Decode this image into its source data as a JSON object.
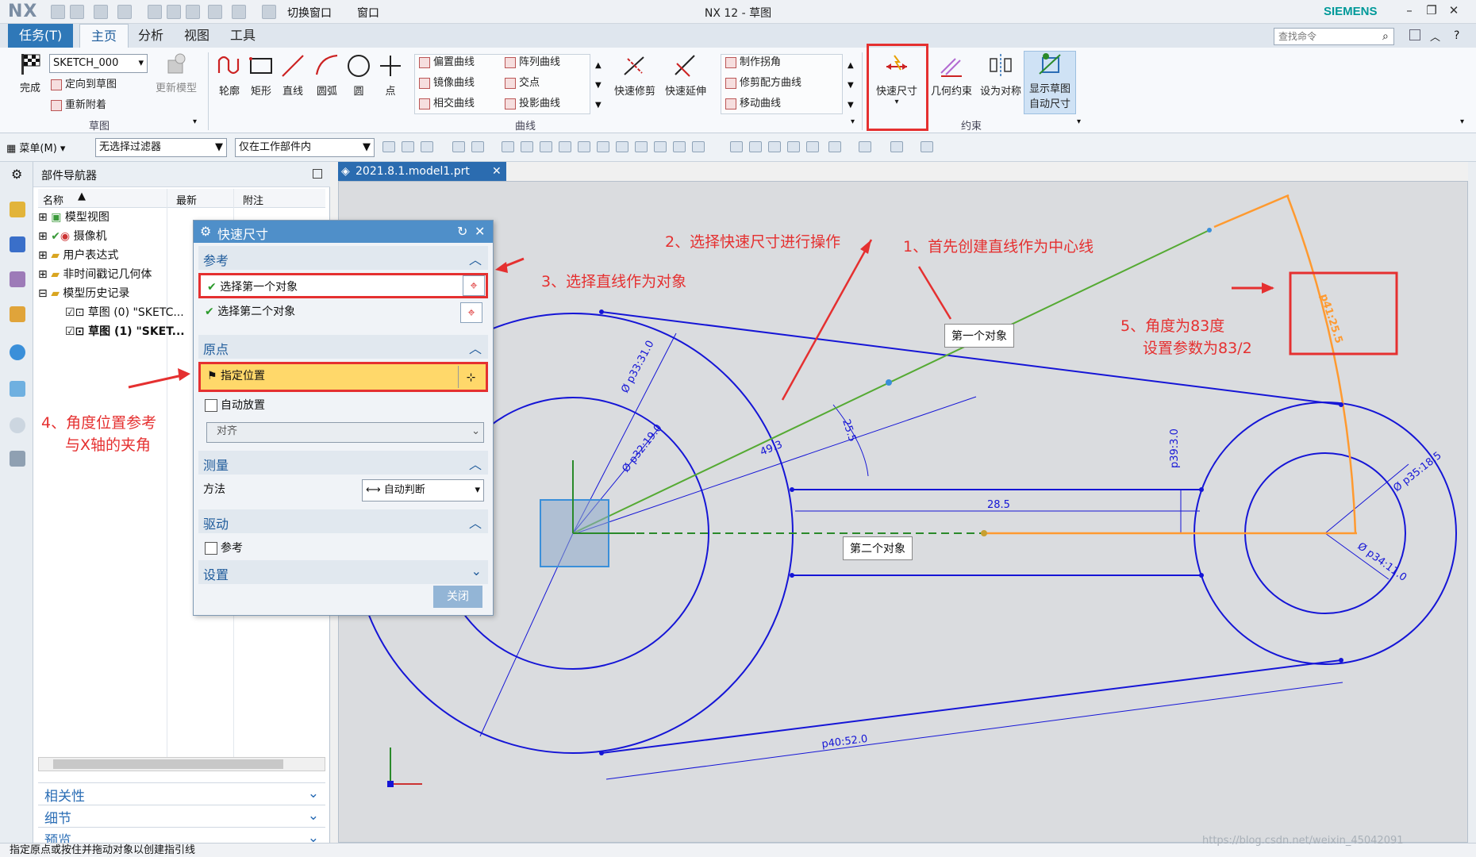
{
  "app": {
    "logo": "NX",
    "title": "NX 12 - 草图",
    "brand": "SIEMENS"
  },
  "menu_tabs": [
    {
      "label": "任务(T)"
    },
    {
      "label": "主页"
    },
    {
      "label": "分析"
    },
    {
      "label": "视图"
    },
    {
      "label": "工具"
    }
  ],
  "quick_access": {
    "switch_window": "切换窗口",
    "window": "窗口"
  },
  "search": {
    "placeholder": "查找命令"
  },
  "ribbon": {
    "sketch_group": {
      "finish": "完成",
      "sketch_name": "SKETCH_000",
      "orient": "定向到草图",
      "reattach": "重新附着",
      "update_model": "更新模型",
      "group_label": "草图"
    },
    "draw": [
      "轮廓",
      "矩形",
      "直线",
      "圆弧",
      "圆",
      "点"
    ],
    "curve_col1": [
      "偏置曲线",
      "镜像曲线",
      "相交曲线"
    ],
    "curve_col2": [
      "阵列曲线",
      "交点",
      "投影曲线"
    ],
    "curve_group_label": "曲线",
    "trim": [
      "快速修剪",
      "快速延伸"
    ],
    "edit_col": [
      "制作拐角",
      "修剪配方曲线",
      "移动曲线"
    ],
    "constraint": {
      "rapid_dim": "快速尺寸",
      "geom": "几何约束",
      "symmetric": "设为对称",
      "show_auto_1": "显示草图",
      "show_auto_2": "自动尺寸",
      "group_label": "约束"
    }
  },
  "toolbar2": {
    "menu": "菜单(M)",
    "filter": "无选择过滤器",
    "scope": "仅在工作部件内"
  },
  "navigator": {
    "title": "部件导航器",
    "columns": [
      "名称",
      "最新",
      "附注"
    ],
    "tree": [
      {
        "label": "模型视图"
      },
      {
        "label": "摄像机"
      },
      {
        "label": "用户表达式"
      },
      {
        "label": "非时间戳记几何体"
      },
      {
        "label": "模型历史记录"
      },
      {
        "label": "草图 (0) \"SKETC..."
      },
      {
        "label": "草图 (1) \"SKET..."
      }
    ],
    "panels": [
      "相关性",
      "细节",
      "预览"
    ]
  },
  "document_tab": "2021.8.1.model1.prt",
  "dialog": {
    "title": "快速尺寸",
    "sections": {
      "reference": "参考",
      "origin": "原点",
      "measure": "测量",
      "drive": "驱动",
      "settings": "设置"
    },
    "first_object": "选择第一个对象",
    "second_object": "选择第二个对象",
    "specify_location": "指定位置",
    "auto_place": "自动放置",
    "align": "对齐",
    "method_label": "方法",
    "method_value": "自动判断",
    "reference_chk": "参考",
    "close": "关闭"
  },
  "annotations": [
    "1、首先创建直线作为中心线",
    "2、选择快速尺寸进行操作",
    "3、选择直线作为对象",
    "4、角度位置参考",
    "与X轴的夹角",
    "5、角度为83度",
    "设置参数为83/2"
  ],
  "canvas_labels": {
    "first_obj": "第一个对象",
    "second_obj": "第二个对象"
  },
  "dimensions": [
    "Ø p33:31.0",
    "Ø p32:19.0",
    "Ø p35:18.5",
    "Ø p34:11.0",
    "p39:3.0",
    "28.5",
    "49.3",
    "25.5",
    "p40:52.0",
    "p41:25.5"
  ],
  "status_text": "指定原点或按住并拖动对象以创建指引线",
  "watermark": "https://blog.csdn.net/weixin_45042091",
  "colors": {
    "accent": "#2f78b8",
    "annotation": "#e53030",
    "sketch": "#1515d6",
    "centerline": "#55aa33",
    "highlight": "#ff9a30"
  }
}
